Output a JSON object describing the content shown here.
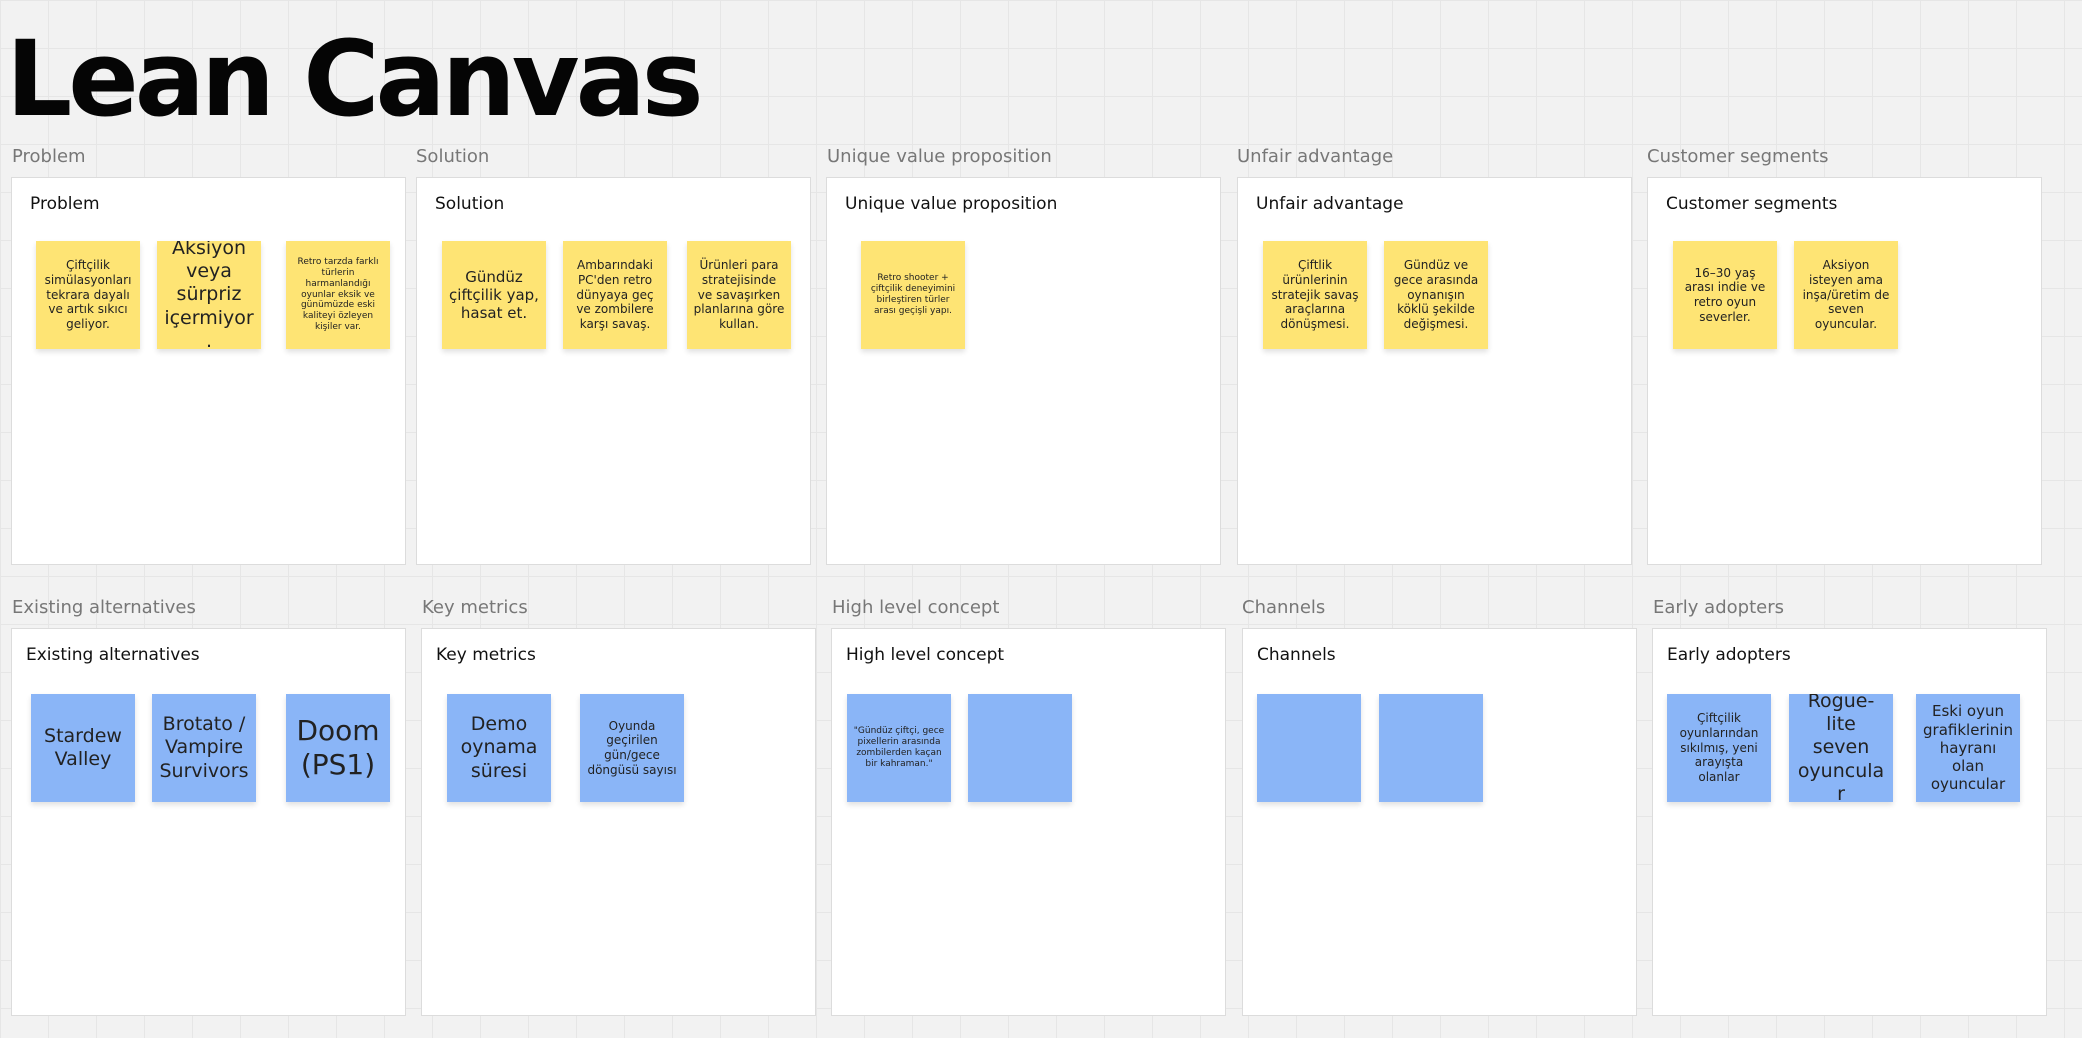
{
  "title": "Lean Canvas",
  "frames": {
    "problem": {
      "label": "Problem",
      "heading": "Problem",
      "notes": [
        "Çiftçilik simülasyonları tekrara dayalı ve artık sıkıcı geliyor.",
        "Aksiyon veya sürpriz içermiyor.",
        "Retro tarzda farklı türlerin harmanlandığı oyunlar eksik ve günümüzde eski kaliteyi özleyen kişiler var."
      ]
    },
    "solution": {
      "label": "Solution",
      "heading": "Solution",
      "notes": [
        "Gündüz çiftçilik yap, hasat et.",
        "Ambarındaki PC'den retro dünyaya geç ve zombilere karşı savaş.",
        "Ürünleri para stratejisinde ve savaşırken planlarına göre kullan."
      ]
    },
    "uvp": {
      "label": "Unique value proposition",
      "heading": "Unique value proposition",
      "notes": [
        "Retro shooter + çiftçilik deneyimini birleştiren türler arası geçişli yapı."
      ]
    },
    "unfair": {
      "label": "Unfair advantage",
      "heading": "Unfair advantage",
      "notes": [
        "Çiftlik ürünlerinin stratejik savaş araçlarına dönüşmesi.",
        "Gündüz ve gece arasında oynanışın köklü şekilde değişmesi."
      ]
    },
    "segments": {
      "label": "Customer segments",
      "heading": "Customer segments",
      "notes": [
        "16–30 yaş arası indie ve retro oyun severler.",
        "Aksiyon isteyen ama inşa/üretim de seven oyuncular."
      ]
    },
    "alternatives": {
      "label": "Existing alternatives",
      "heading": "Existing alternatives",
      "notes": [
        "Stardew Valley",
        "Brotato / Vampire Survivors",
        "Doom (PS1)"
      ]
    },
    "metrics": {
      "label": "Key metrics",
      "heading": "Key metrics",
      "notes": [
        "Demo oynama süresi",
        "Oyunda geçirilen gün/gece döngüsü sayısı"
      ]
    },
    "concept": {
      "label": "High level concept",
      "heading": "High level concept",
      "notes": [
        "\"Gündüz çiftçi, gece pixellerin arasında zombilerden kaçan bir kahraman.\""
      ]
    },
    "channels": {
      "label": "Channels",
      "heading": "Channels",
      "notes": []
    },
    "adopters": {
      "label": "Early adopters",
      "heading": "Early adopters",
      "notes": [
        "Çiftçilik oyunlarından sıkılmış, yeni arayışta olanlar",
        "Rogue-lite seven oyuncular",
        "Eski oyun grafiklerinin hayranı olan oyuncular"
      ]
    }
  },
  "colors": {
    "sticky_yellow": "#fee474",
    "sticky_blue": "#8ab5f7",
    "canvas_background": "#f2f2f2"
  }
}
